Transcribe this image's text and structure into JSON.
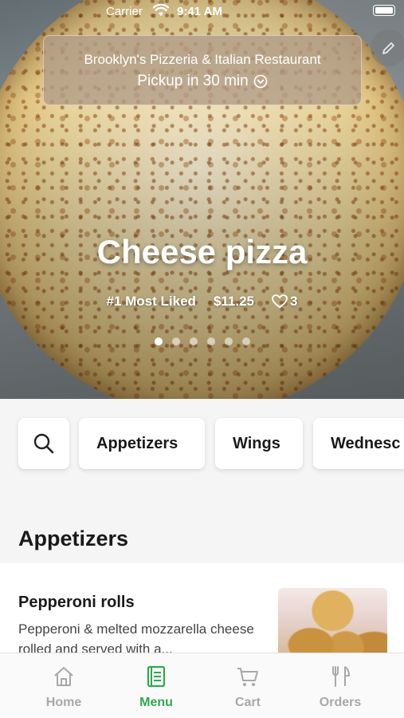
{
  "status_bar": {
    "carrier": "Carrier",
    "time": "9:41 AM"
  },
  "store": {
    "name": "Brooklyn's Pizzeria & Italian Restaurant",
    "pickup": "Pickup in 30 min"
  },
  "hero": {
    "title": "Cheese pizza",
    "badge": "#1 Most Liked",
    "price": "$11.25",
    "likes": "3",
    "carousel_total": 6,
    "carousel_active": 1
  },
  "categories": [
    {
      "label": "Appetizers"
    },
    {
      "label": "Wings"
    },
    {
      "label": "Wednesc"
    }
  ],
  "section": {
    "title": "Appetizers"
  },
  "item": {
    "name": "Pepperoni rolls",
    "description": "Pepperoni & melted mozzarella cheese rolled and served with a..."
  },
  "tabs": [
    {
      "label": "Home",
      "icon": "home-icon"
    },
    {
      "label": "Menu",
      "icon": "menu-book-icon"
    },
    {
      "label": "Cart",
      "icon": "cart-icon"
    },
    {
      "label": "Orders",
      "icon": "fork-knife-icon"
    }
  ],
  "colors": {
    "accent": "#2fa84f",
    "inactive": "#a8a8a8"
  }
}
